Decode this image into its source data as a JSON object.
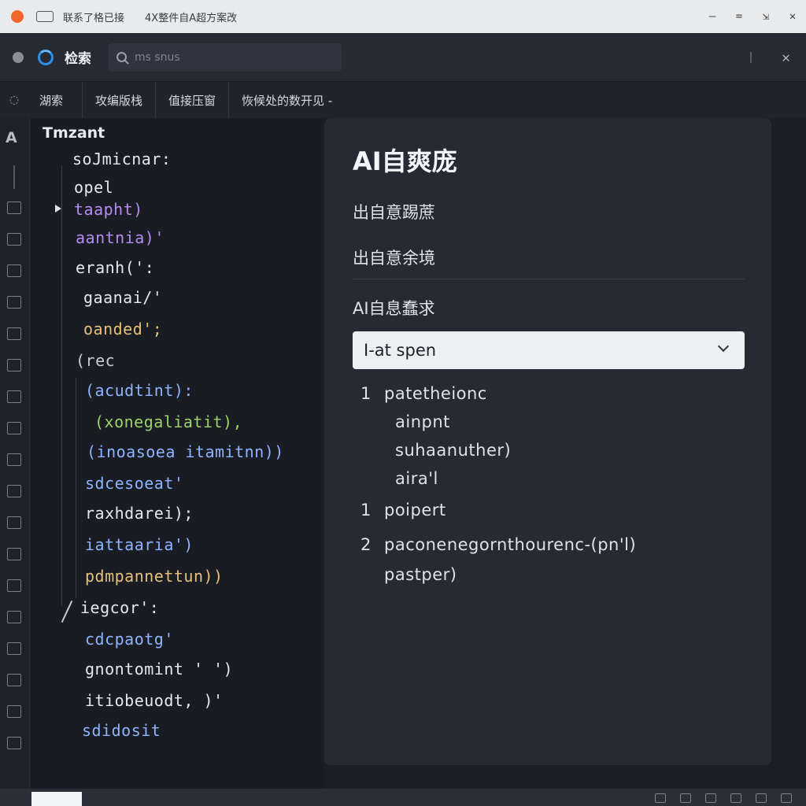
{
  "window": {
    "title": "联系了格已接",
    "subtitle": "4X整件自A超方案改"
  },
  "toolbar": {
    "label": "检索",
    "search_placeholder": "ms snus"
  },
  "tabs": [
    {
      "label": "湖索"
    },
    {
      "label": "攻编版栈"
    },
    {
      "label": "值接压窗"
    },
    {
      "label": "恢候处的数开见 -"
    }
  ],
  "code": {
    "title": "Tmzant",
    "lines": [
      {
        "text": "soJmicnar:",
        "color": "#e6e8ec"
      },
      {
        "text": "opel",
        "color": "#e6e8ec"
      },
      {
        "text": "taapht)",
        "color": "#b58cf0"
      },
      {
        "text": "aantnia)'",
        "color": "#b58cf0"
      },
      {
        "text": "eranh(':",
        "color": "#e6e8ec"
      },
      {
        "text": "gaanai/'",
        "color": "#e6e8ec"
      },
      {
        "text": "oanded';",
        "color": "#e6c07b"
      },
      {
        "text": "(rec",
        "color": "#c9ccd2"
      },
      {
        "text": "(acudtint):",
        "color": "#8fb4ff"
      },
      {
        "text": "(xonegaliatit),",
        "color": "#9bd36a"
      },
      {
        "text": "(inoasoea itamitnn))",
        "color": "#8fb4ff"
      },
      {
        "text": "sdcesoeat'",
        "color": "#8fb4ff"
      },
      {
        "text": "raxhdarei);",
        "color": "#e6e8ec"
      },
      {
        "text": "iattaaria')",
        "color": "#8fb4ff"
      },
      {
        "text": "pdmpannettun))",
        "color": "#e6c07b"
      },
      {
        "text": "iegcor':",
        "color": "#e6e8ec"
      },
      {
        "text": "cdcpaotg'",
        "color": "#8fb4ff"
      },
      {
        "text": "gnontomint ' ')",
        "color": "#e6e8ec"
      },
      {
        "text": "itiobeuodt, )'",
        "color": "#e6e8ec"
      },
      {
        "text": "sdidosit",
        "color": "#8fb4ff"
      }
    ]
  },
  "panel": {
    "title": "AI自爽庞",
    "items": [
      "出自意踢蔗",
      "出自意余境"
    ],
    "section_label": "AI自息蠢求",
    "select_value": "I-at spen",
    "results": [
      {
        "num": "1",
        "text": "patetheionc"
      },
      {
        "num": "",
        "text": "ainpnt"
      },
      {
        "num": "",
        "text": "suhaanuther)"
      },
      {
        "num": "",
        "text": "aira'l"
      },
      {
        "num": "1",
        "text": "poipert"
      },
      {
        "num": "2",
        "text": "paconenegornthourenc-(pn'l)"
      },
      {
        "num": "",
        "text": "pastper)"
      }
    ]
  },
  "colors": {
    "accent": "#2c8fe6",
    "titlebar_dot": "#f2672a",
    "panel_bg": "#262a32",
    "editor_bg": "#191c22"
  }
}
